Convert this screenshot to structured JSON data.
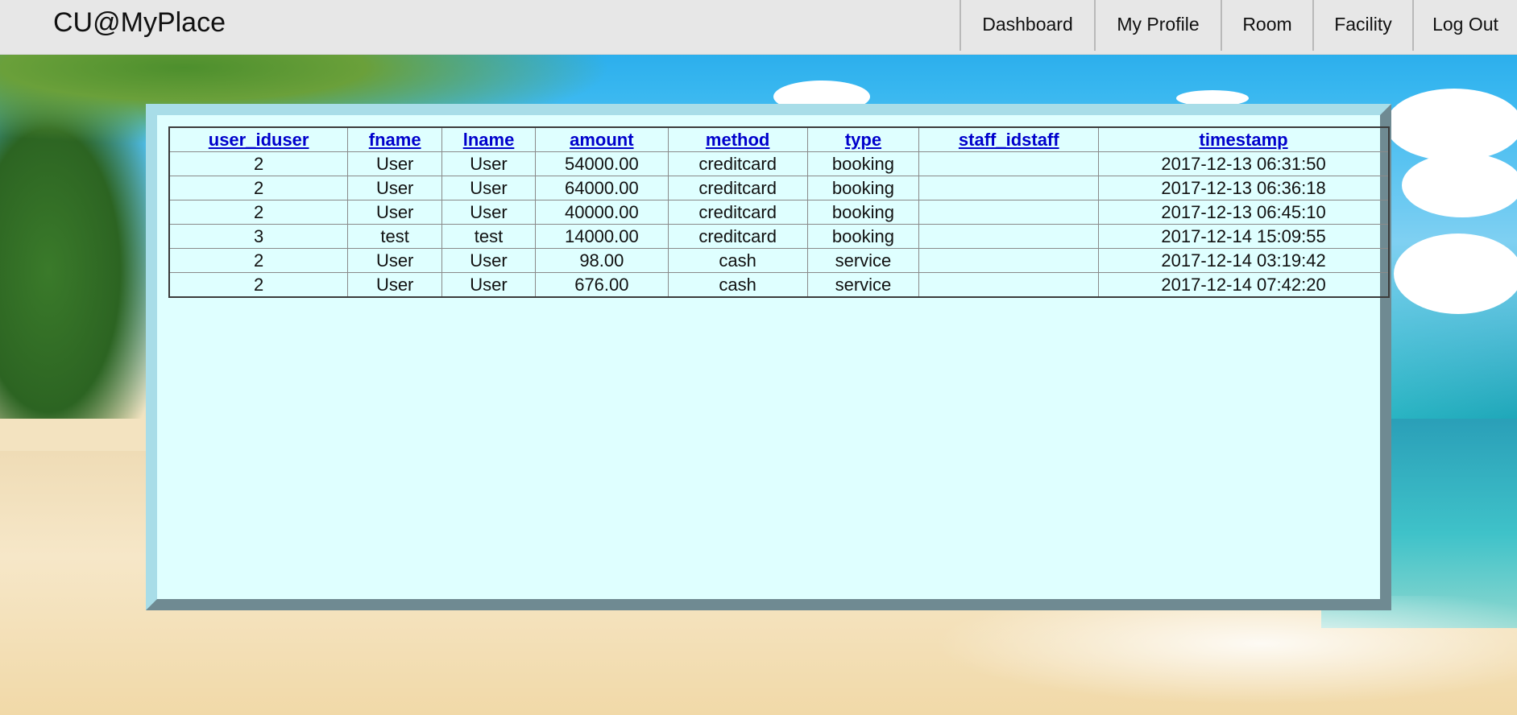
{
  "brand": "CU@MyPlace",
  "nav": [
    "Dashboard",
    "My Profile",
    "Room",
    "Facility",
    "Log Out"
  ],
  "table": {
    "columns": [
      "user_iduser",
      "fname",
      "lname",
      "amount",
      "method",
      "type",
      "staff_idstaff",
      "timestamp"
    ],
    "rows": [
      [
        "2",
        "User",
        "User",
        "54000.00",
        "creditcard",
        "booking",
        "",
        "2017-12-13 06:31:50"
      ],
      [
        "2",
        "User",
        "User",
        "64000.00",
        "creditcard",
        "booking",
        "",
        "2017-12-13 06:36:18"
      ],
      [
        "2",
        "User",
        "User",
        "40000.00",
        "creditcard",
        "booking",
        "",
        "2017-12-13 06:45:10"
      ],
      [
        "3",
        "test",
        "test",
        "14000.00",
        "creditcard",
        "booking",
        "",
        "2017-12-14 15:09:55"
      ],
      [
        "2",
        "User",
        "User",
        "98.00",
        "cash",
        "service",
        "",
        "2017-12-14 03:19:42"
      ],
      [
        "2",
        "User",
        "User",
        "676.00",
        "cash",
        "service",
        "",
        "2017-12-14 07:42:20"
      ]
    ]
  }
}
